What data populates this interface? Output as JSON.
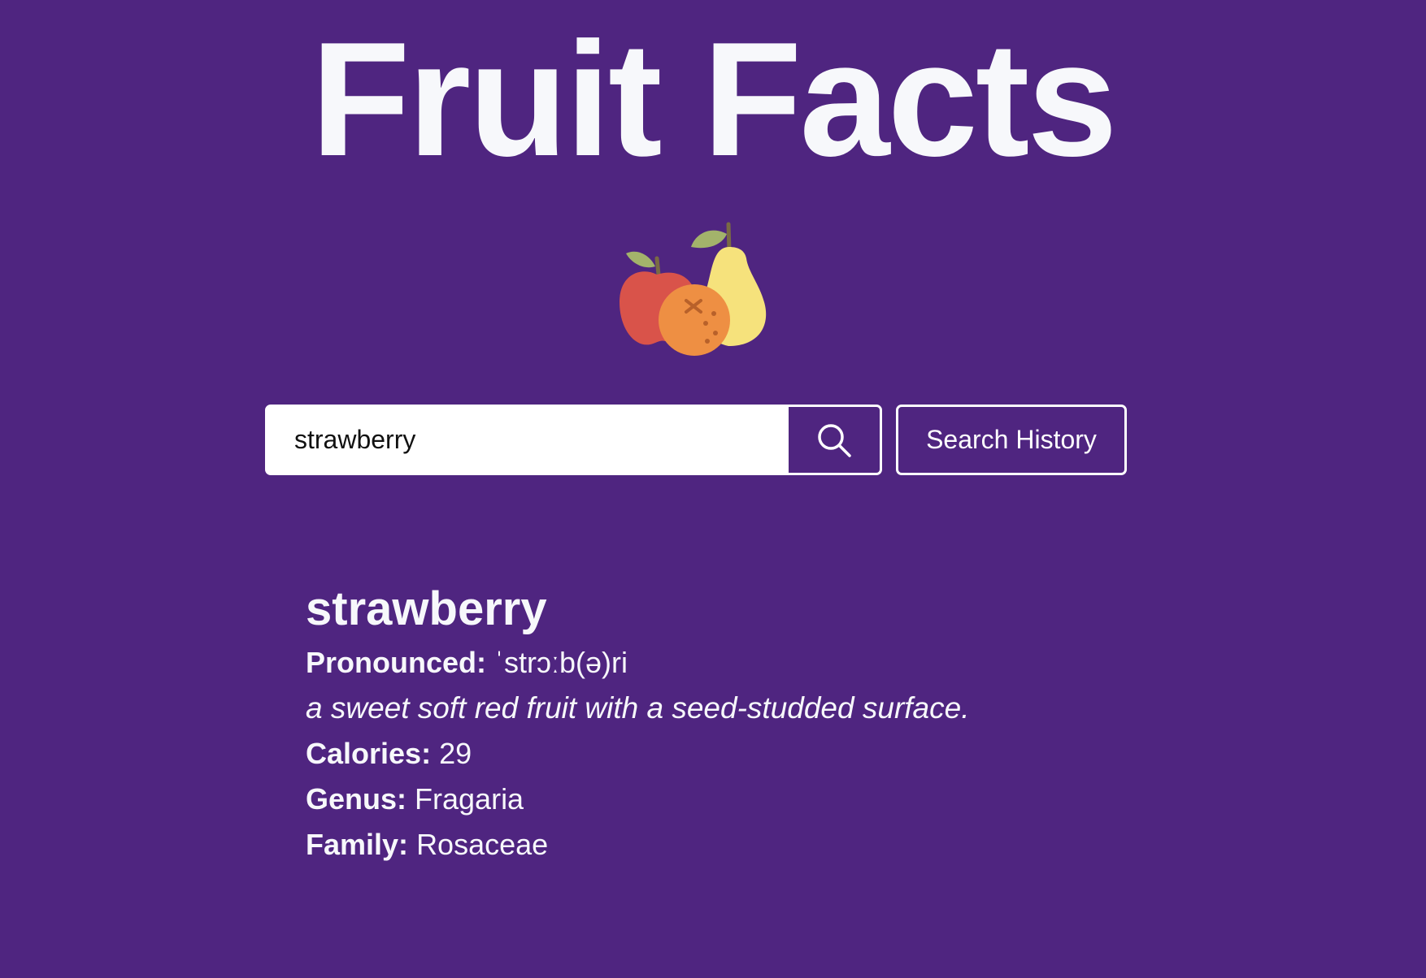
{
  "header": {
    "title": "Fruit Facts",
    "logo_icon": "fruit-basket-icon"
  },
  "search": {
    "value": "strawberry",
    "placeholder": "",
    "button_icon": "search-icon",
    "history_label": "Search History"
  },
  "result": {
    "name": "strawberry",
    "pronounced_label": "Pronounced:",
    "pronounced_value": "ˈstrɔːb(ə)ri",
    "description": "a sweet soft red fruit with a seed-studded surface.",
    "calories_label": "Calories:",
    "calories_value": "29",
    "genus_label": "Genus:",
    "genus_value": "Fragaria",
    "family_label": "Family:",
    "family_value": "Rosaceae"
  },
  "colors": {
    "background": "#4f2580",
    "text": "#f7f8fb",
    "accent_border": "#ffffff",
    "apple": "#d9534a",
    "orange": "#ee8f43",
    "pear": "#f6e27c",
    "leaf": "#a3b36b"
  }
}
